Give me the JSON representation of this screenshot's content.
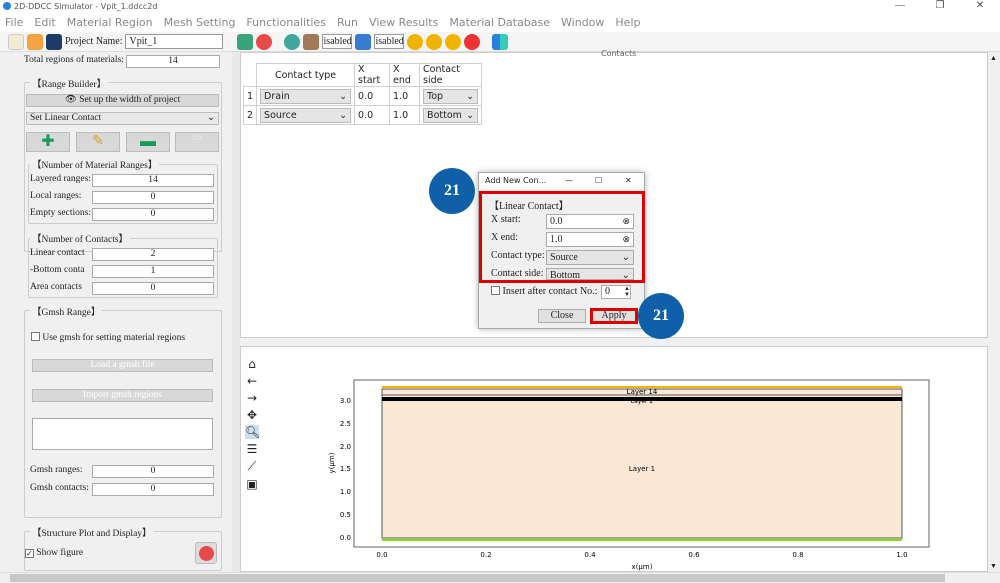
{
  "window": {
    "title": "2D-DDCC Simulator - Vpit_1.ddcc2d",
    "minimize": "—",
    "maximize": "❐",
    "close": "✕"
  },
  "menu": [
    "File",
    "Edit",
    "Material Region",
    "Mesh Setting",
    "Functionalities",
    "Run",
    "View Results",
    "Material Database",
    "Window",
    "Help"
  ],
  "toolbar": {
    "project_label": "Project Name:",
    "project_name": "Vpit_1",
    "disabled1": "isabled",
    "disabled2": "isabled"
  },
  "left": {
    "total_regions_label": "Total regions of materials:",
    "total_regions": "14",
    "range_builder": "【Range Builder】",
    "setup_width": "Set up the width of project",
    "contact_mode": "Set Linear Contact",
    "num_ranges_title": "【Number of Material Ranges】",
    "layered_label": "Layered ranges:",
    "layered": "14",
    "local_label": "Local ranges:",
    "local": "0",
    "empty_label": "Empty sections:",
    "empty": "0",
    "num_contacts_title": "【Number of Contacts】",
    "linear_label": "Linear contact",
    "linear": "2",
    "bottom_label": "-Bottom conta",
    "bottom": "1",
    "area_label": "Area contacts",
    "area": "0",
    "gmsh_title": "【Gmsh Range】",
    "gmsh_check": "Use gmsh for setting material regions",
    "load_gmsh": "Load a gmsh file",
    "import_gmsh": "Import gmsh regions",
    "gmsh_ranges_label": "Gmsh ranges:",
    "gmsh_ranges": "0",
    "gmsh_contacts_label": "Gmsh contacts:",
    "gmsh_contacts": "0",
    "structure_title": "【Structure Plot and Display】",
    "show_figure": "Show figure"
  },
  "contacts": {
    "title": "Contacts",
    "headers": [
      "Contact type",
      "X start",
      "X end",
      "Contact side"
    ],
    "rows": [
      {
        "n": "1",
        "type": "Drain",
        "xs": "0.0",
        "xe": "1.0",
        "side": "Top"
      },
      {
        "n": "2",
        "type": "Source",
        "xs": "0.0",
        "xe": "1.0",
        "side": "Bottom"
      }
    ]
  },
  "dialog": {
    "title": "Add New Con...",
    "group": "【Linear Contact】",
    "xstart_label": "X start:",
    "xstart": "0.0",
    "xend_label": "X end:",
    "xend": "1.0",
    "type_label": "Contact type:",
    "type": "Source",
    "side_label": "Contact side:",
    "side": "Bottom",
    "insert_label": "Insert after contact No.:",
    "insert_no": "0",
    "close": "Close",
    "apply": "Apply"
  },
  "badges": [
    "21",
    "21"
  ],
  "plot": {
    "xlabel": "x(μm)",
    "ylabel": "y(μm)",
    "xticks": [
      "0.0",
      "0.2",
      "0.4",
      "0.6",
      "0.8",
      "1.0"
    ],
    "yticks": [
      "0.0",
      "0.5",
      "1.0",
      "1.5",
      "2.0",
      "2.5",
      "3.0"
    ],
    "labels": [
      "Layer 14",
      "Layer 2",
      "Layer 1"
    ],
    "colors": {
      "fill": "#f8e8d4",
      "top_contact": "#ffb000",
      "bottom_contact": "#7ee000",
      "band": "#000000"
    }
  }
}
